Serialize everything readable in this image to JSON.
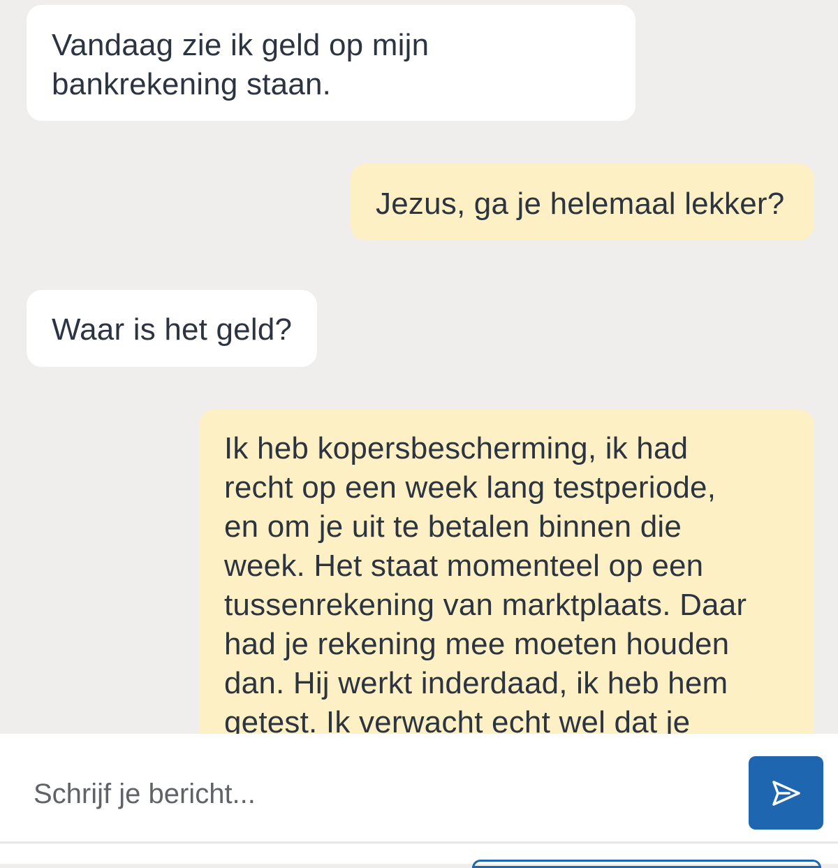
{
  "conversation": {
    "messages": [
      {
        "direction": "incoming",
        "text": "Vandaag zie ik geld op mijn\nbankrekening staan."
      },
      {
        "direction": "outgoing",
        "text": "Jezus, ga je helemaal lekker?"
      },
      {
        "direction": "incoming",
        "text": "Waar is het geld?"
      },
      {
        "direction": "outgoing",
        "text": "Ik heb kopersbescherming, ik had\nrecht op een week lang testperiode,\nen om je uit te betalen binnen die\nweek. Het staat momenteel op een\ntussenrekening van marktplaats. Daar\nhad je rekening mee moeten houden\ndan. Hij werkt inderdaad, ik heb hem\ngetest. Ik verwacht echt wel dat je"
      }
    ]
  },
  "composer": {
    "placeholder": "Schrijf je bericht...",
    "value": "",
    "send_icon": "send-paper-plane-icon"
  },
  "colors": {
    "background": "#efeeec",
    "incoming_bubble": "#ffffff",
    "outgoing_bubble": "#fdf0c5",
    "accent": "#1f66b1",
    "text": "#2b3440"
  }
}
